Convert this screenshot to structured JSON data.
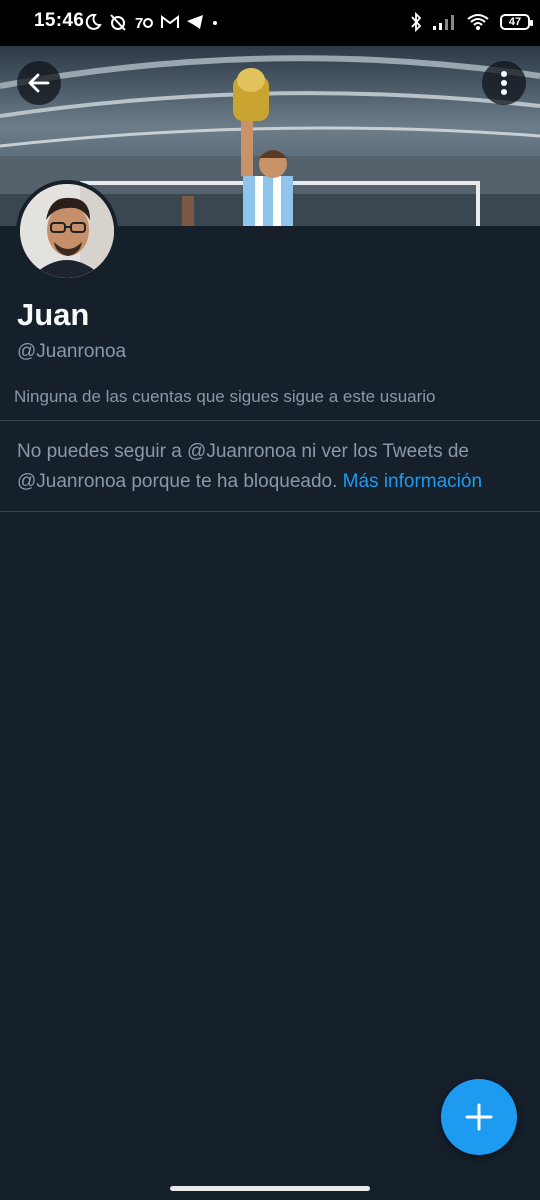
{
  "status_bar": {
    "time": "15:46",
    "battery": "47",
    "left_icons": [
      "moon-icon",
      "alarm-off-icon",
      "app-notification-icon",
      "gmail-icon",
      "telegram-icon",
      "dot-icon"
    ],
    "right_icons": [
      "bluetooth-icon",
      "signal-icon",
      "wifi-icon",
      "battery-icon"
    ]
  },
  "profile": {
    "display_name": "Juan",
    "handle": "@Juanronoa",
    "follow_info": "Ninguna de las cuentas que sigues sigue a este usuario",
    "blocked_message": "No puedes seguir a @Juanronoa ni ver los Tweets de @Juanronoa porque te ha bloqueado.",
    "learn_more": "Más información"
  },
  "colors": {
    "background": "#15202b",
    "accent": "#1d9bf0",
    "secondary_text": "#8b98a5",
    "divider": "#38444d"
  }
}
